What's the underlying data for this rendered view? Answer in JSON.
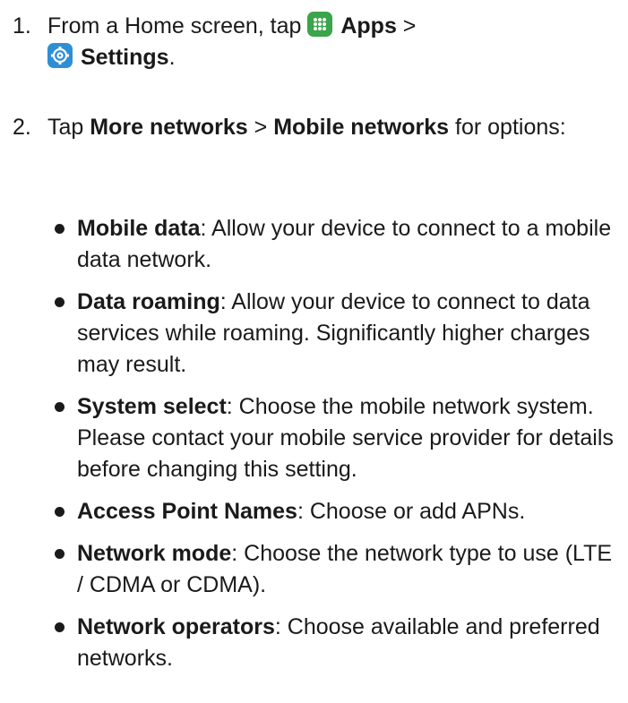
{
  "step1": {
    "number": "1.",
    "prefix": "From a Home screen, tap ",
    "apps_label": "Apps",
    "separator": " >",
    "settings_label": "Settings",
    "suffix": "."
  },
  "step2": {
    "number": "2.",
    "prefix": "Tap ",
    "more_networks": "More networks",
    "separator": " > ",
    "mobile_networks": "Mobile networks",
    "suffix": " for options:"
  },
  "options": [
    {
      "term": "Mobile data",
      "desc": ": Allow your device to connect to a mobile data network."
    },
    {
      "term": "Data roaming",
      "desc": ": Allow your device to connect to data services while roaming. Significantly higher charges may result."
    },
    {
      "term": "System select",
      "desc": ": Choose the mobile network system. Please contact your mobile service provider for details before changing this setting."
    },
    {
      "term": "Access Point Names",
      "desc": ": Choose or add APNs."
    },
    {
      "term": "Network mode",
      "desc": ": Choose the network type to use (LTE / CDMA or CDMA)."
    },
    {
      "term": "Network operators",
      "desc": ": Choose available and preferred networks."
    }
  ],
  "icons": {
    "apps": "apps-grid-icon",
    "settings": "settings-gear-icon"
  },
  "colors": {
    "apps_icon": "#3aa54a",
    "settings_icon": "#2f8fd6",
    "text": "#1a1a1a"
  }
}
